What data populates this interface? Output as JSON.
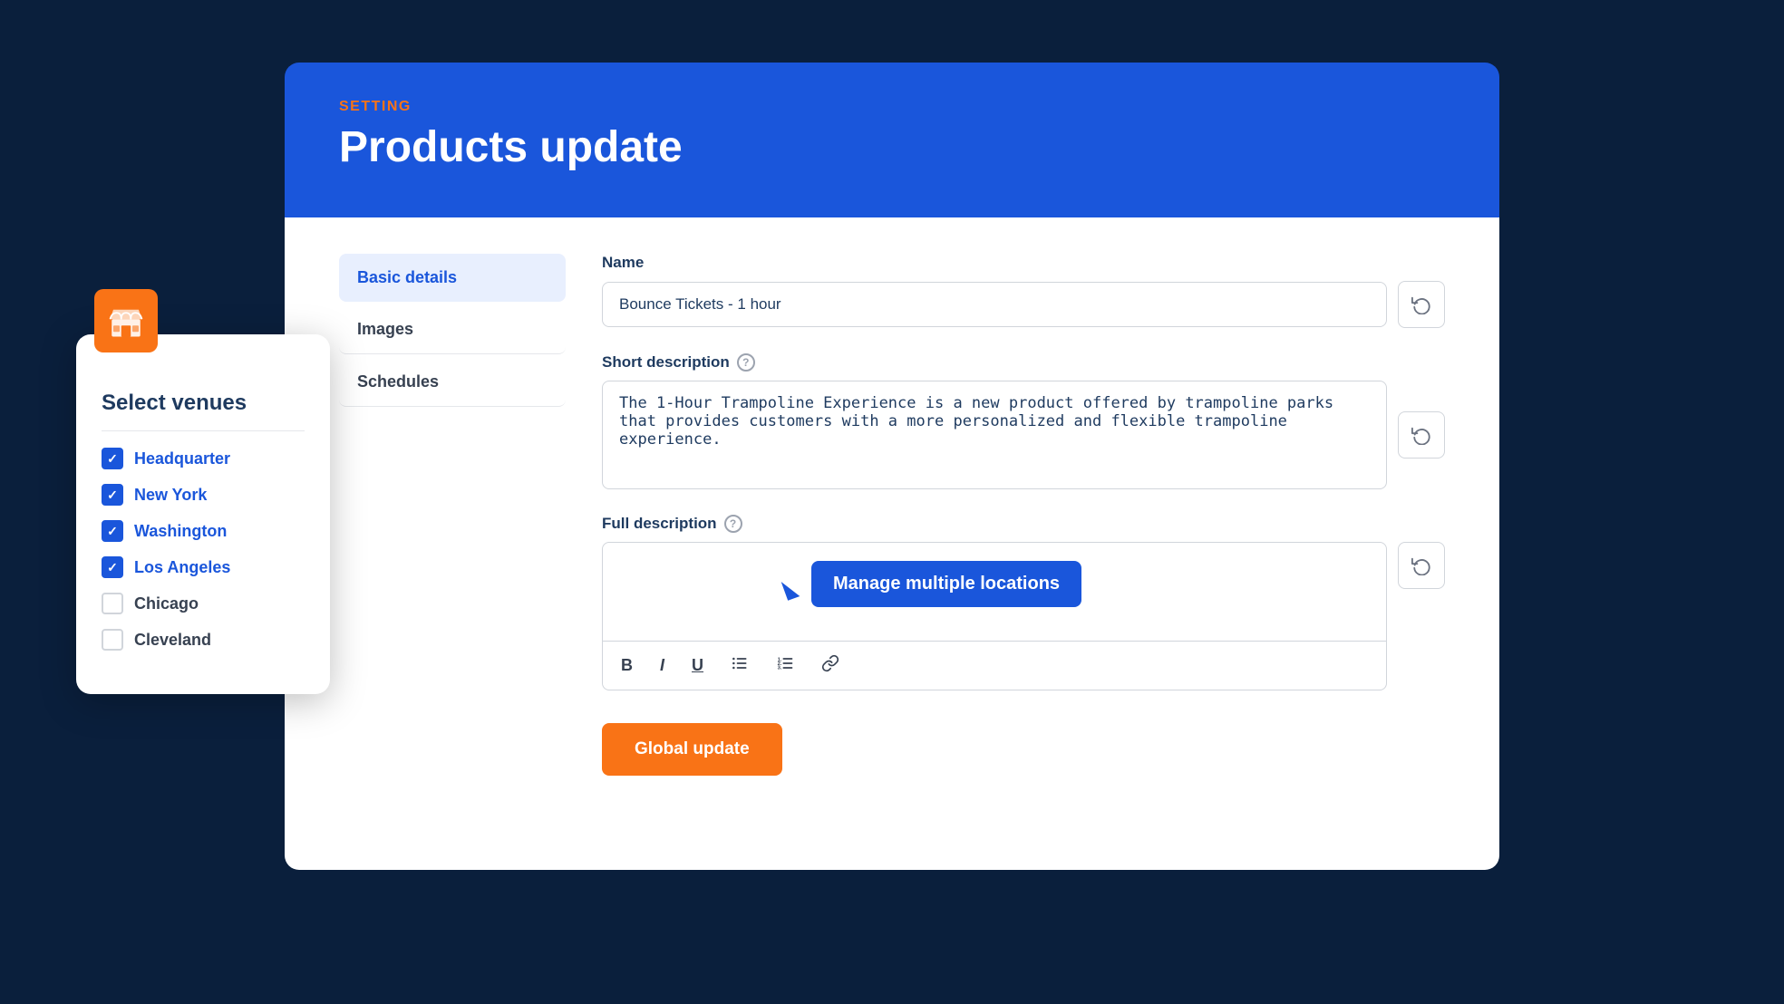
{
  "header": {
    "setting_label": "SETTING",
    "title": "Products update"
  },
  "nav": {
    "items": [
      {
        "id": "basic-details",
        "label": "Basic details",
        "active": true
      },
      {
        "id": "images",
        "label": "Images",
        "active": false
      },
      {
        "id": "schedules",
        "label": "Schedules",
        "active": false
      }
    ]
  },
  "form": {
    "name_label": "Name",
    "name_value": "Bounce Tickets - 1 hour",
    "short_desc_label": "Short description",
    "short_desc_value": "The 1-Hour Trampoline Experience is a new product offered by trampoline parks that provides customers with a more personalized and flexible trampoline experience.",
    "full_desc_label": "Full description",
    "full_desc_value": "",
    "tooltip_text": "Manage multiple locations",
    "global_update_label": "Global update"
  },
  "toolbar": {
    "bold": "B",
    "italic": "I",
    "underline": "U",
    "bullet_list": "•",
    "ordered_list": "1.",
    "link": "🔗"
  },
  "venue_panel": {
    "title": "Select venues",
    "venues": [
      {
        "id": "headquarter",
        "label": "Headquarter",
        "checked": true
      },
      {
        "id": "new-york",
        "label": "New York",
        "checked": true
      },
      {
        "id": "washington",
        "label": "Washington",
        "checked": true
      },
      {
        "id": "los-angeles",
        "label": "Los Angeles",
        "checked": true
      },
      {
        "id": "chicago",
        "label": "Chicago",
        "checked": false
      },
      {
        "id": "cleveland",
        "label": "Cleveland",
        "checked": false
      }
    ]
  }
}
